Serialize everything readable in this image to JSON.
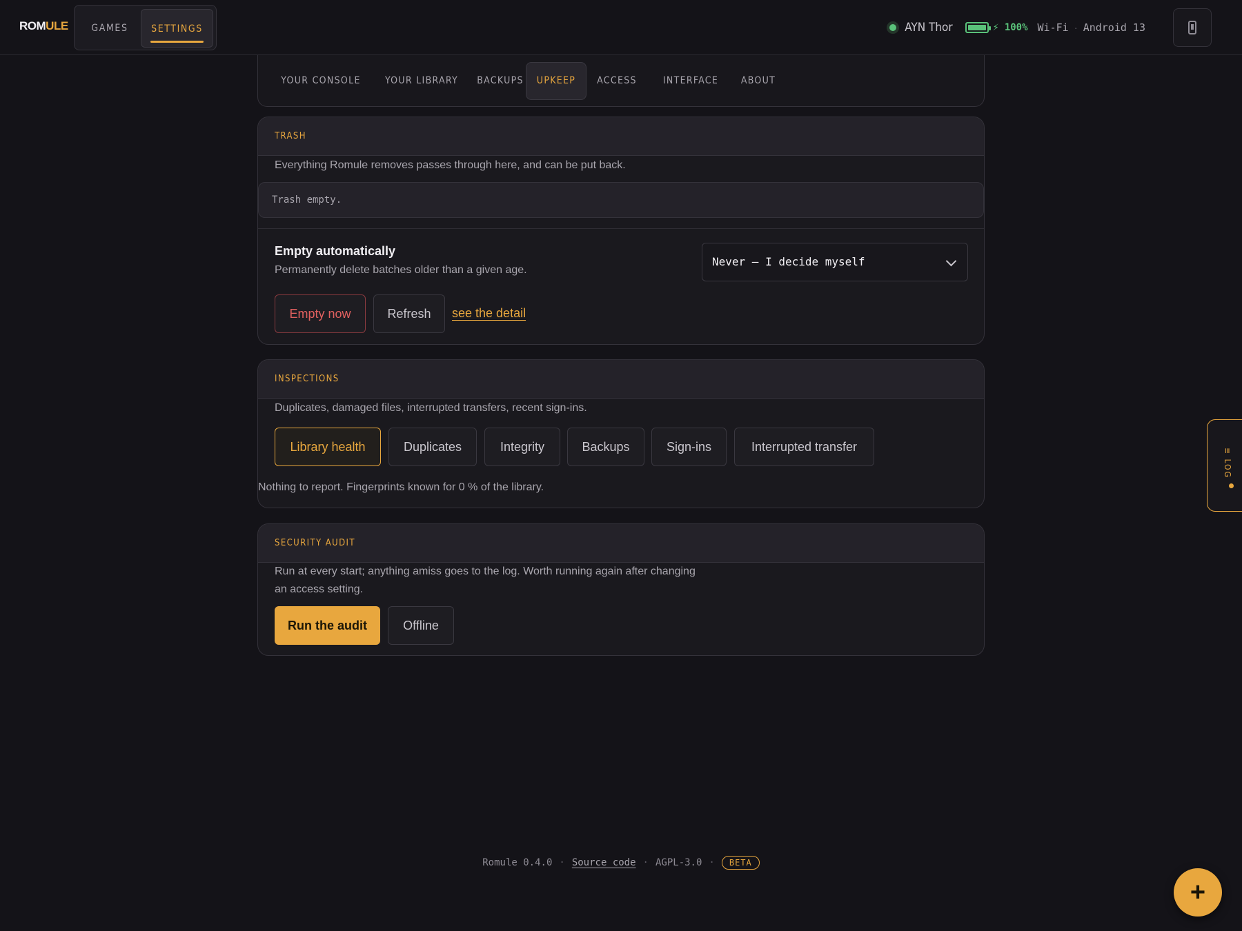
{
  "topbar": {
    "logo_a": "ROM",
    "logo_b": "ULE",
    "tabs": [
      {
        "label": "GAMES"
      },
      {
        "label": "SETTINGS"
      }
    ],
    "device": "AYN Thor",
    "battery_percent": "100%",
    "battery_level": 1.0,
    "network": "Wi-Fi",
    "os": "Android 13"
  },
  "subnav": {
    "tabs": [
      {
        "label": "YOUR CONSOLE"
      },
      {
        "label": "YOUR LIBRARY"
      },
      {
        "label": "BACKUPS"
      },
      {
        "label": "UPKEEP"
      },
      {
        "label": "ACCESS"
      },
      {
        "label": "INTERFACE"
      },
      {
        "label": "ABOUT"
      }
    ],
    "active": "UPKEEP"
  },
  "trash": {
    "title": "TRASH",
    "description": "Everything Romule removes passes through here, and can be put back.",
    "status": "Trash empty.",
    "auto_label": "Empty automatically",
    "auto_help": "Permanently delete batches older than a given age.",
    "auto_value": "Never — I decide myself",
    "empty_now": "Empty now",
    "refresh": "Refresh",
    "detail_link": "see the detail"
  },
  "inspections": {
    "title": "INSPECTIONS",
    "description": "Duplicates, damaged files, interrupted transfers, recent sign-ins.",
    "buttons": [
      {
        "label": "Library health"
      },
      {
        "label": "Duplicates"
      },
      {
        "label": "Integrity"
      },
      {
        "label": "Backups"
      },
      {
        "label": "Sign-ins"
      },
      {
        "label": "Interrupted transfer"
      }
    ],
    "selected": "Library health",
    "result": "Nothing to report. Fingerprints known for 0 % of the library."
  },
  "audit": {
    "title": "SECURITY AUDIT",
    "description_1": "Run at every start; anything amiss goes to the log. Worth running again after changing",
    "description_2": "an access setting.",
    "run": "Run the audit",
    "offline": "Offline"
  },
  "footer": {
    "version": "Romule 0.4.0",
    "source": "Source code",
    "license": "AGPL-3.0",
    "badge": "BETA"
  },
  "log_tab": {
    "label": "≡ LOG"
  },
  "fab": {
    "label": "+"
  },
  "colors": {
    "accent": "#e8a73e",
    "danger": "#e0605f",
    "ok": "#5ac27a",
    "background": "#141318"
  }
}
